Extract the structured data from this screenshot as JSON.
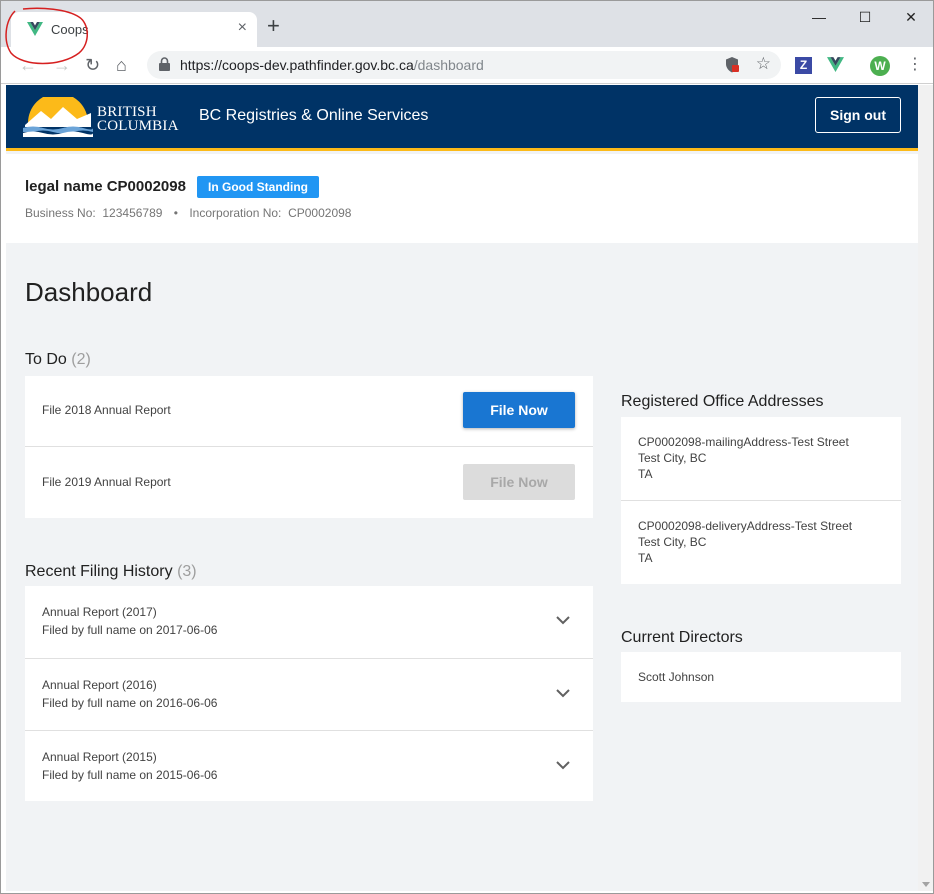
{
  "browser": {
    "tab_title": "Coops",
    "tab_close": "×",
    "new_tab": "+",
    "url_host": "https://coops-dev.pathfinder.gov.bc.ca",
    "url_path": "/dashboard",
    "window_controls": {
      "minimize": "—",
      "maximize": "☐",
      "close": "✕"
    },
    "extensions": {
      "z_label": "Z",
      "avatar_letter": "W"
    },
    "menu_icon": "⋮",
    "nav": {
      "back": "←",
      "forward": "→",
      "reload": "↻",
      "home": "⌂"
    },
    "star": "☆"
  },
  "header": {
    "logo_line1": "BRITISH",
    "logo_line2": "COLUMBIA",
    "app_title": "BC Registries & Online Services",
    "signout_label": "Sign out"
  },
  "entity": {
    "legal_name": "legal name CP0002098",
    "status_badge": "In Good Standing",
    "business_no_label": "Business No:",
    "business_no": "123456789",
    "separator": "•",
    "incorporation_no_label": "Incorporation No:",
    "incorporation_no": "CP0002098"
  },
  "page_title": "Dashboard",
  "todo": {
    "title": "To Do",
    "count": "(2)",
    "items": [
      {
        "label": "File 2018 Annual Report",
        "button": "File Now",
        "enabled": true
      },
      {
        "label": "File 2019 Annual Report",
        "button": "File Now",
        "enabled": false
      }
    ]
  },
  "history": {
    "title": "Recent Filing History",
    "count": "(3)",
    "items": [
      {
        "title": "Annual Report (2017)",
        "subtitle": "Filed by full name on 2017-06-06"
      },
      {
        "title": "Annual Report (2016)",
        "subtitle": "Filed by full name on 2016-06-06"
      },
      {
        "title": "Annual Report (2015)",
        "subtitle": "Filed by full name on 2015-06-06"
      }
    ]
  },
  "addresses": {
    "title": "Registered Office Addresses",
    "items": [
      {
        "line1": "CP0002098-mailingAddress-Test Street",
        "line2": "Test City, BC",
        "line3": "TA"
      },
      {
        "line1": "CP0002098-deliveryAddress-Test Street",
        "line2": "Test City, BC",
        "line3": "TA"
      }
    ]
  },
  "directors": {
    "title": "Current Directors",
    "items": [
      {
        "name": "Scott Johnson"
      }
    ]
  },
  "colors": {
    "header_bg": "#003366",
    "header_accent": "#fcba19",
    "primary_button": "#1976d2",
    "badge": "#2196f3"
  }
}
